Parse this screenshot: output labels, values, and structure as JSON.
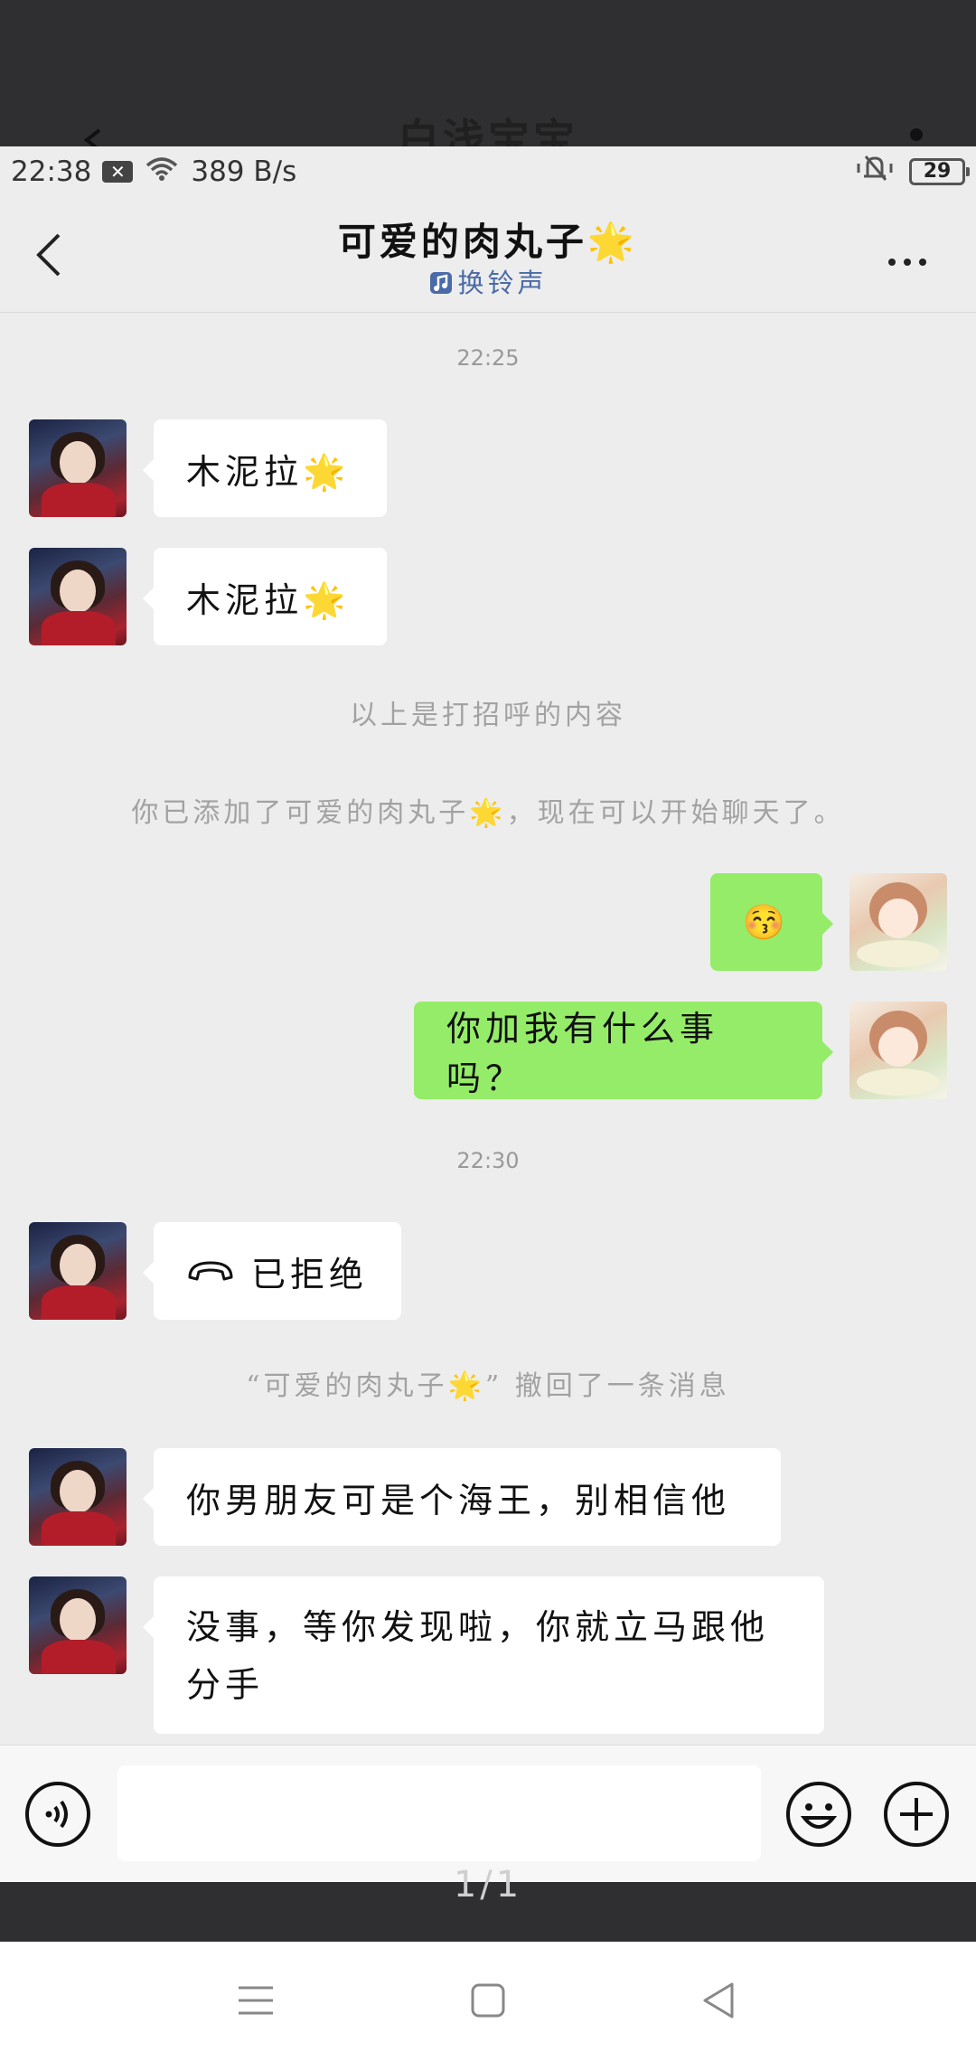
{
  "background_app": {
    "title": "白浅宝宝"
  },
  "status_bar": {
    "time": "22:38",
    "notification_icon": "x-box-icon",
    "network_speed": "389 B/s",
    "battery": "29"
  },
  "header": {
    "title": "可爱的肉丸子🌟",
    "subtitle": "换铃声"
  },
  "messages": [
    {
      "type": "time",
      "text": "22:25"
    },
    {
      "type": "incoming",
      "text": "木泥拉🌟"
    },
    {
      "type": "incoming",
      "text": "木泥拉🌟"
    },
    {
      "type": "system",
      "text": "以上是打招呼的内容"
    },
    {
      "type": "system",
      "text": "你已添加了可爱的肉丸子🌟，现在可以开始聊天了。"
    },
    {
      "type": "outgoing",
      "text": "😚"
    },
    {
      "type": "outgoing",
      "text": "你加我有什么事吗？"
    },
    {
      "type": "time",
      "text": "22:30"
    },
    {
      "type": "incoming",
      "text": "已拒绝",
      "icon": "phone-hangup-icon"
    },
    {
      "type": "system",
      "text": "“可爱的肉丸子🌟” 撤回了一条消息"
    },
    {
      "type": "incoming",
      "text": "你男朋友可是个海王，别相信他"
    },
    {
      "type": "incoming",
      "text": "没事，等你发现啦，你就立马跟他分手"
    }
  ],
  "input_bar": {
    "placeholder": ""
  },
  "page_indicator": "1/1",
  "colors": {
    "outgoing_bubble": "#95ec69",
    "incoming_bubble": "#ffffff",
    "chat_background": "#ededed",
    "subtitle_blue": "#4a6aa8"
  }
}
